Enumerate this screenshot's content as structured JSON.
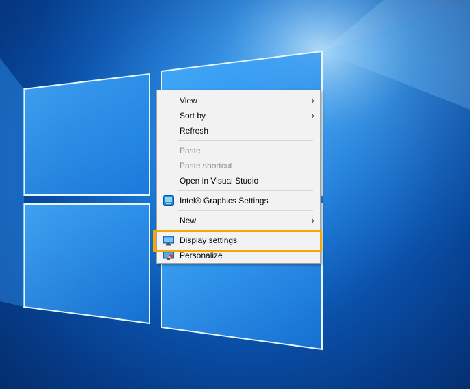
{
  "context_menu": {
    "items": [
      {
        "label": "View",
        "enabled": true,
        "submenu": true
      },
      {
        "label": "Sort by",
        "enabled": true,
        "submenu": true
      },
      {
        "label": "Refresh",
        "enabled": true,
        "submenu": false
      },
      {
        "label": "Paste",
        "enabled": false,
        "submenu": false
      },
      {
        "label": "Paste shortcut",
        "enabled": false,
        "submenu": false
      },
      {
        "label": "Open in Visual Studio",
        "enabled": true,
        "submenu": false
      },
      {
        "label": "Intel® Graphics Settings",
        "enabled": true,
        "submenu": false,
        "icon": "intel-graphics-icon"
      },
      {
        "label": "New",
        "enabled": true,
        "submenu": true
      },
      {
        "label": "Display settings",
        "enabled": true,
        "submenu": false,
        "icon": "display-icon",
        "highlighted": true
      },
      {
        "label": "Personalize",
        "enabled": true,
        "submenu": false,
        "icon": "personalize-icon"
      }
    ],
    "submenu_arrow": "›"
  },
  "colors": {
    "highlight_border": "#f5a800",
    "menu_background": "#f2f2f2",
    "disabled_text": "#8d8d8d"
  }
}
